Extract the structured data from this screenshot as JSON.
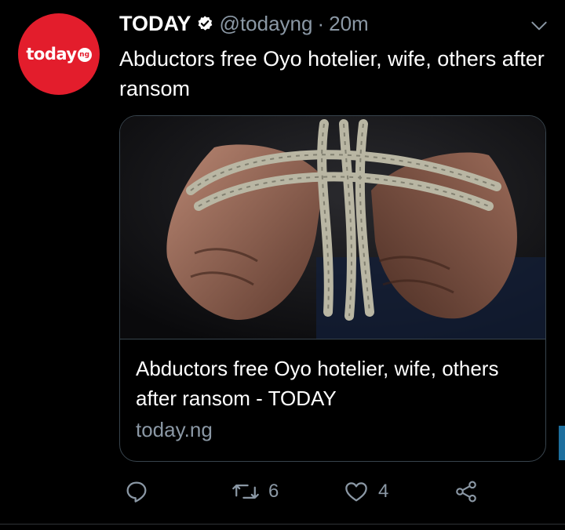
{
  "tweet": {
    "author_name": "TODAY",
    "handle": "@todayng",
    "separator": "·",
    "time": "20m",
    "text": "Abductors free Oyo hotelier, wife, others after ransom",
    "avatar_logo_text": "today",
    "avatar_logo_badge": "ng"
  },
  "card": {
    "title": "Abductors free Oyo hotelier, wife, others after ransom - TODAY",
    "domain": "today.ng"
  },
  "actions": {
    "reply_count": "",
    "retweet_count": "6",
    "like_count": "4"
  },
  "colors": {
    "background": "#000000",
    "brand_red": "#e31d2c",
    "secondary_text": "#8b98a5",
    "border": "#38444d"
  },
  "icons": [
    "verified-badge-icon",
    "chevron-down-icon",
    "reply-icon",
    "retweet-icon",
    "like-icon",
    "share-icon"
  ]
}
